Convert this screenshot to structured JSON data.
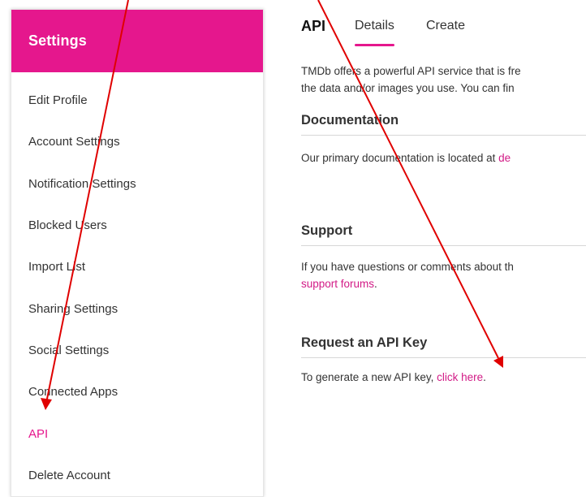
{
  "sidebar": {
    "title": "Settings",
    "items": [
      {
        "label": "Edit Profile"
      },
      {
        "label": "Account Settings"
      },
      {
        "label": "Notification Settings"
      },
      {
        "label": "Blocked Users"
      },
      {
        "label": "Import List"
      },
      {
        "label": "Sharing Settings"
      },
      {
        "label": "Social Settings"
      },
      {
        "label": "Connected Apps"
      },
      {
        "label": "API"
      },
      {
        "label": "Delete Account"
      }
    ],
    "active_item": "API"
  },
  "main": {
    "tabs": {
      "title": "API",
      "details": "Details",
      "create": "Create"
    },
    "intro": {
      "line1": "TMDb offers a powerful API service that is fre",
      "line2": "the data and/or images you use. You can fin"
    },
    "documentation": {
      "title": "Documentation",
      "text": "Our primary documentation is located at ",
      "link": "de"
    },
    "support": {
      "title": "Support",
      "text": "If you have questions or comments about th",
      "link": "support forums",
      "suffix": "."
    },
    "request": {
      "title": "Request an API Key",
      "text": "To generate a new API key, ",
      "link": "click here",
      "suffix": "."
    }
  },
  "colors": {
    "accent": "#e5178d",
    "link": "#d21a86",
    "annotation_arrow": "#e00000"
  }
}
